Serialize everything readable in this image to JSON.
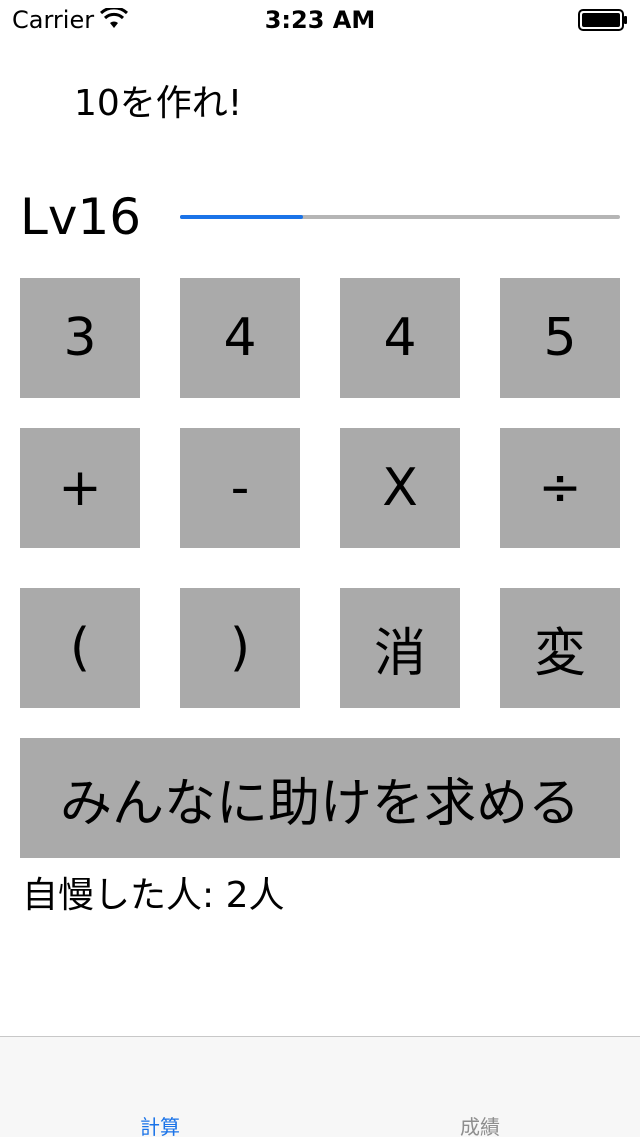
{
  "status_bar": {
    "carrier": "Carrier",
    "time": "3:23 AM"
  },
  "prompt": "10を作れ!",
  "level": {
    "label": "Lv16",
    "progress": 0.28
  },
  "number_keys": [
    "3",
    "4",
    "4",
    "5"
  ],
  "operator_keys": [
    "+",
    "-",
    "X",
    "÷"
  ],
  "function_keys": [
    "(",
    ")",
    "消",
    "変"
  ],
  "help_button": "みんなに助けを求める",
  "boast_text": "自慢した人: 2人",
  "tabs": [
    {
      "label": "計算",
      "active": true
    },
    {
      "label": "成績",
      "active": false
    }
  ],
  "colors": {
    "key_background": "#aaaaaa",
    "accent": "#1a73e8",
    "progress_track": "#b5b5b5"
  }
}
